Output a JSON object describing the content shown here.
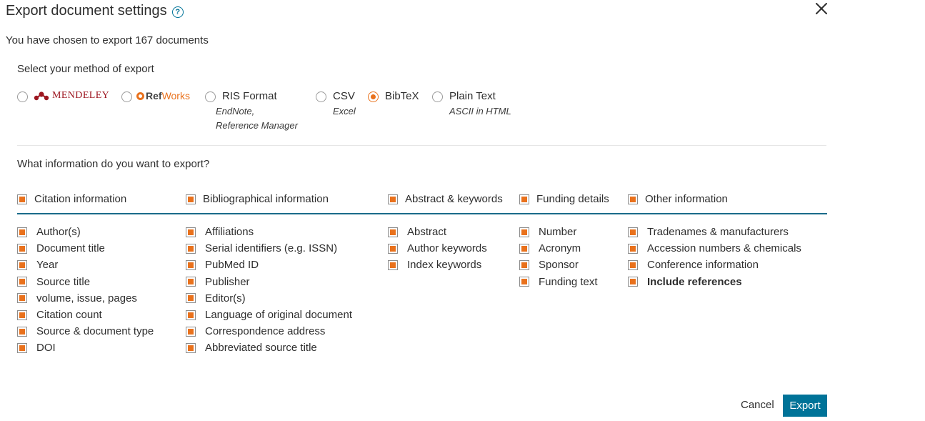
{
  "header": {
    "title": "Export document settings",
    "help_icon": "question-circle-icon",
    "close_icon": "close-x-icon"
  },
  "summary": "You have chosen to export 167 documents",
  "export_method": {
    "label": "Select your method of export",
    "selected": "BibTeX",
    "options": [
      {
        "id": "mendeley",
        "label": "MENDELEY",
        "logo": true
      },
      {
        "id": "refworks",
        "label_ref": "Ref",
        "label_works": "Works",
        "logo": true
      },
      {
        "id": "ris",
        "label": "RIS Format",
        "sub1": "EndNote,",
        "sub2": "Reference Manager"
      },
      {
        "id": "csv",
        "label": "CSV",
        "sub1": "Excel"
      },
      {
        "id": "bibtex",
        "label": "BibTeX"
      },
      {
        "id": "plain",
        "label": "Plain Text",
        "sub1": "ASCII in HTML"
      }
    ]
  },
  "info": {
    "label": "What information do you want to export?",
    "groups": [
      {
        "header": "Citation information",
        "items": [
          "Author(s)",
          "Document title",
          "Year",
          "Source title",
          "volume, issue, pages",
          "Citation count",
          "Source & document type",
          "DOI"
        ]
      },
      {
        "header": "Bibliographical information",
        "items": [
          "Affiliations",
          "Serial identifiers (e.g. ISSN)",
          "PubMed ID",
          "Publisher",
          "Editor(s)",
          "Language of original document",
          "Correspondence address",
          "Abbreviated source title"
        ]
      },
      {
        "header": "Abstract & keywords",
        "items": [
          "Abstract",
          "Author keywords",
          "Index keywords"
        ]
      },
      {
        "header": "Funding details",
        "items": [
          "Number",
          "Acronym",
          "Sponsor",
          "Funding text"
        ]
      },
      {
        "header": "Other information",
        "items": [
          "Tradenames & manufacturers",
          "Accession numbers & chemicals",
          "Conference information",
          "Include references"
        ]
      }
    ]
  },
  "actions": {
    "cancel": "Cancel",
    "export": "Export"
  },
  "colors": {
    "accent": "#e9711c",
    "primary": "#007398",
    "divider": "#1a6b8a"
  }
}
